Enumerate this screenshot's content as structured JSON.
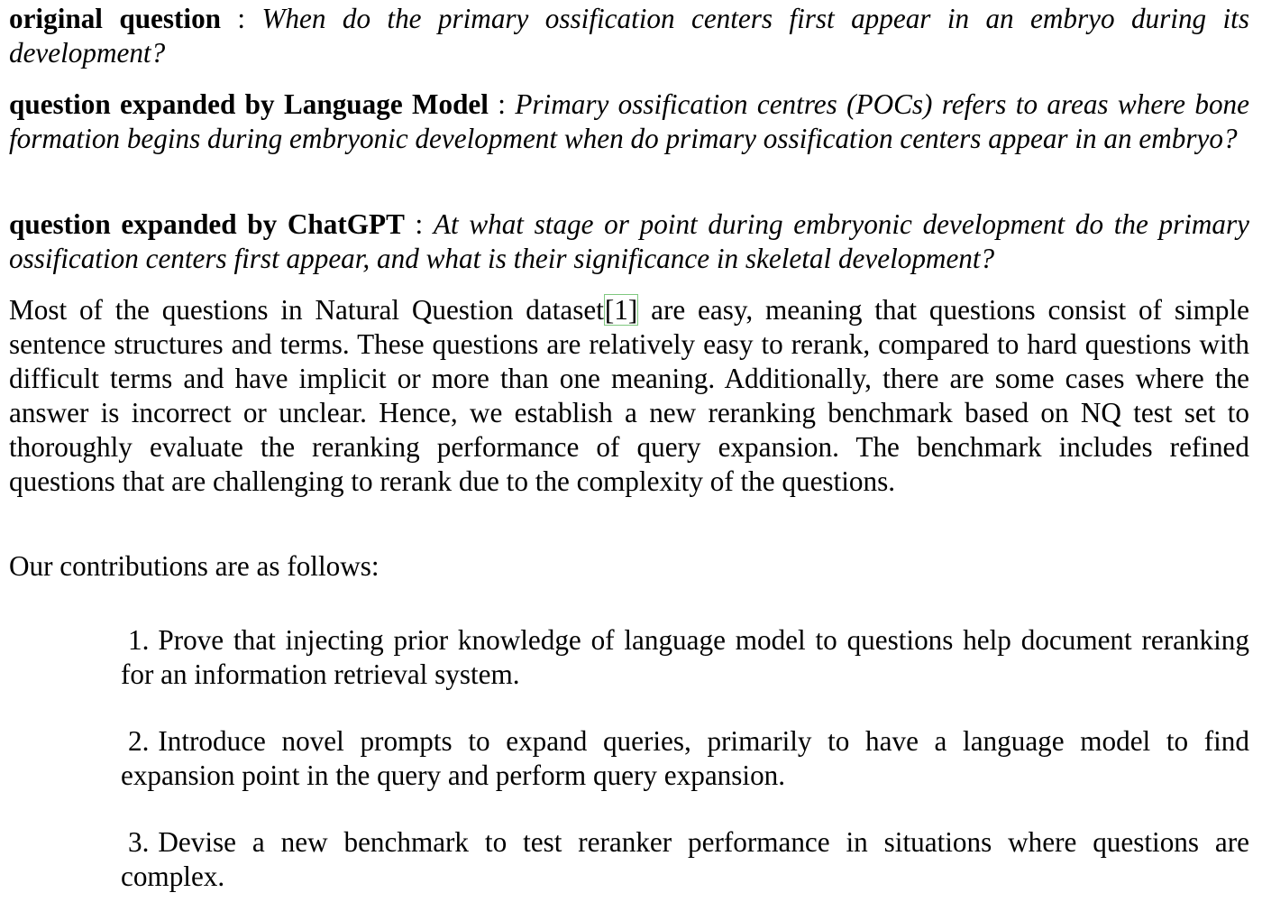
{
  "questions": {
    "original": {
      "label": "original question",
      "sep": " : ",
      "text": "When do the primary ossification centers first appear in an embryo during its development?"
    },
    "lm": {
      "label": "question expanded by Language Model",
      "sep": " : ",
      "text": "Primary ossification centres (POCs) refers to areas where bone formation begins during embryonic development when do primary ossification centers appear in an embryo?"
    },
    "chatgpt": {
      "label": "question expanded by ChatGPT",
      "sep": " : ",
      "text": "At what stage or point during embryonic development do the primary ossification centers first appear, and what is their significance in skeletal development?"
    }
  },
  "body": {
    "before_cite": "Most of the questions in Natural Question dataset",
    "cite": "[1]",
    "after_cite": " are easy, meaning that questions consist of simple sentence structures and terms. These questions are relatively easy to rerank, compared to hard questions with difficult terms and have implicit or more than one meaning. Additionally, there are some cases where the answer is incorrect or unclear. Hence, we establish a new reranking benchmark based on NQ test set to thoroughly evaluate the reranking performance of query expansion.  The benchmark includes refined questions that are challenging to rerank due to the complexity of the questions."
  },
  "contributions": {
    "intro": "Our contributions are as follows:",
    "items": [
      {
        "num": "1.",
        "text": "Prove that injecting prior knowledge of language model to questions help document reranking for an information retrieval system."
      },
      {
        "num": "2.",
        "text": "Introduce novel prompts to expand queries, primarily to have a language model to find expansion point in the query and perform query expansion."
      },
      {
        "num": "3.",
        "text": "Devise a new benchmark to test reranker performance in situations where questions are complex."
      }
    ]
  }
}
